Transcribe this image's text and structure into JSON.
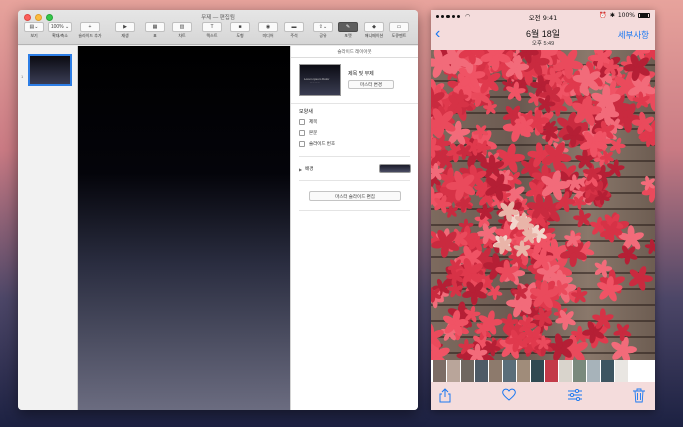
{
  "keynote": {
    "window_title": "무제 — 편집됨",
    "toolbar": [
      {
        "name": "view",
        "label": "보기",
        "glyph": "▤⌄"
      },
      {
        "name": "zoom",
        "label": "확대/축소",
        "glyph": "100% ⌄"
      },
      {
        "name": "add-slide",
        "label": "슬라이드 추가",
        "glyph": "+"
      },
      {
        "name": "play",
        "label": "재생",
        "glyph": "▶"
      },
      {
        "name": "table",
        "label": "표",
        "glyph": "▦"
      },
      {
        "name": "chart",
        "label": "차트",
        "glyph": "▥"
      },
      {
        "name": "text",
        "label": "텍스트",
        "glyph": "T"
      },
      {
        "name": "shape",
        "label": "도형",
        "glyph": "■"
      },
      {
        "name": "media",
        "label": "미디어",
        "glyph": "◉"
      },
      {
        "name": "comment",
        "label": "주석",
        "glyph": "▬"
      },
      {
        "name": "share",
        "label": "공유",
        "glyph": "⇪⌄"
      },
      {
        "name": "format",
        "label": "포맷",
        "glyph": "✎"
      },
      {
        "name": "animate",
        "label": "애니메이션",
        "glyph": "◆"
      },
      {
        "name": "document",
        "label": "도큐멘트",
        "glyph": "▭"
      }
    ],
    "slide_number": "1",
    "inspector": {
      "header": "슬라이드 레이아웃",
      "layout_name": "제목 및 부제",
      "layout_thumb_title": "Lorem ipsum Dolor",
      "change_master_label": "마스터 변경",
      "appearance_label": "모양새",
      "checks": [
        {
          "label": "제목",
          "checked": false
        },
        {
          "label": "본문",
          "checked": false
        },
        {
          "label": "슬라이드 번호",
          "checked": false
        }
      ],
      "background_label": "배경",
      "edit_master_label": "마스터 슬라이드 편집"
    }
  },
  "photos": {
    "status": {
      "time": "오전 9:41",
      "battery": "100%"
    },
    "nav": {
      "back_icon": "chevron-left",
      "date": "6월 18일",
      "time": "오후 5:49",
      "edit_label": "세부사항"
    },
    "filmstrip_colors": [
      "#7c6d66",
      "#b9a59a",
      "#6f6760",
      "#4d5a66",
      "#8d7a6c",
      "#5b6e7a",
      "#a08c7a",
      "#2f4a52",
      "#c33a48",
      "#d9d4cc",
      "#7a8a7d",
      "#a7b3ba",
      "#3d5561",
      "#e9e6e2"
    ],
    "toolbar_icons": [
      "share-icon",
      "heart-icon",
      "adjust-icon",
      "trash-icon"
    ]
  },
  "colors": {
    "ios_blue": "#1a78f2",
    "leaf_red": "#e0394d"
  }
}
